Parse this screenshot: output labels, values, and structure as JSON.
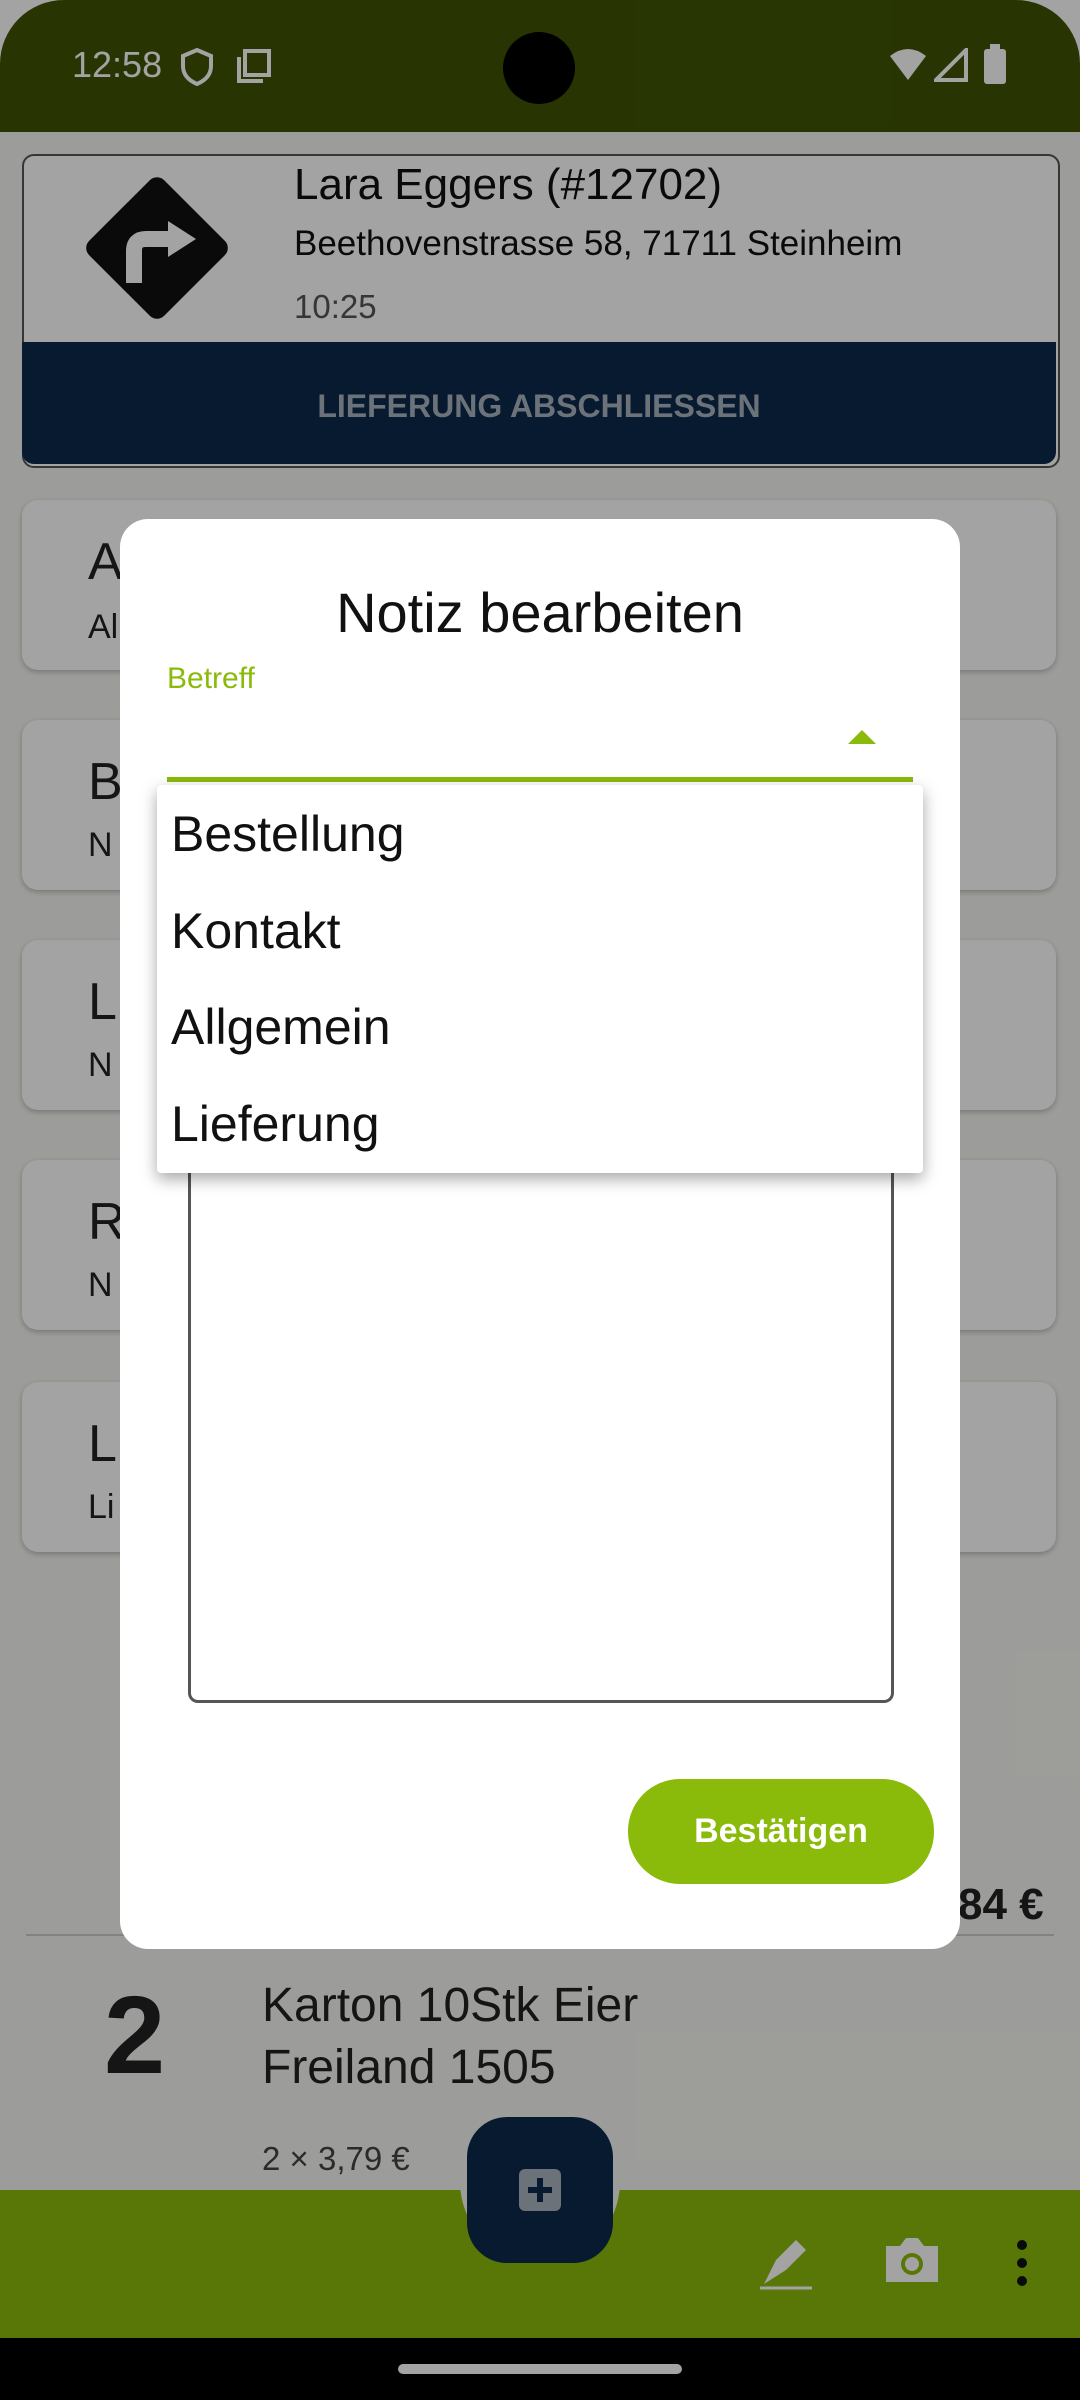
{
  "status_bar": {
    "time": "12:58"
  },
  "delivery": {
    "customer_name": "Lara Eggers (#12702)",
    "address": "Beethovenstrasse 58, 71711 Steinheim",
    "time": "10:25",
    "finish_label": "LIEFERUNG ABSCHLIESSEN"
  },
  "notes_behind": [
    {
      "letter": "A",
      "sub": "Al"
    },
    {
      "letter": "B",
      "sub": "N"
    },
    {
      "letter": "L",
      "sub": "N"
    },
    {
      "letter": "R",
      "sub": "N"
    },
    {
      "letter": "L",
      "sub": "Li"
    }
  ],
  "items": {
    "item1_total": "84 €",
    "item2": {
      "qty": "2",
      "name_line1": "Karton 10Stk Eier",
      "name_line2": "Freiland 1505",
      "price": "2 × 3,79 €"
    }
  },
  "dialog": {
    "title": "Notiz bearbeiten",
    "subject_label": "Betreff",
    "options": [
      "Bestellung",
      "Kontakt",
      "Allgemein",
      "Lieferung"
    ],
    "confirm_label": "Bestätigen"
  }
}
